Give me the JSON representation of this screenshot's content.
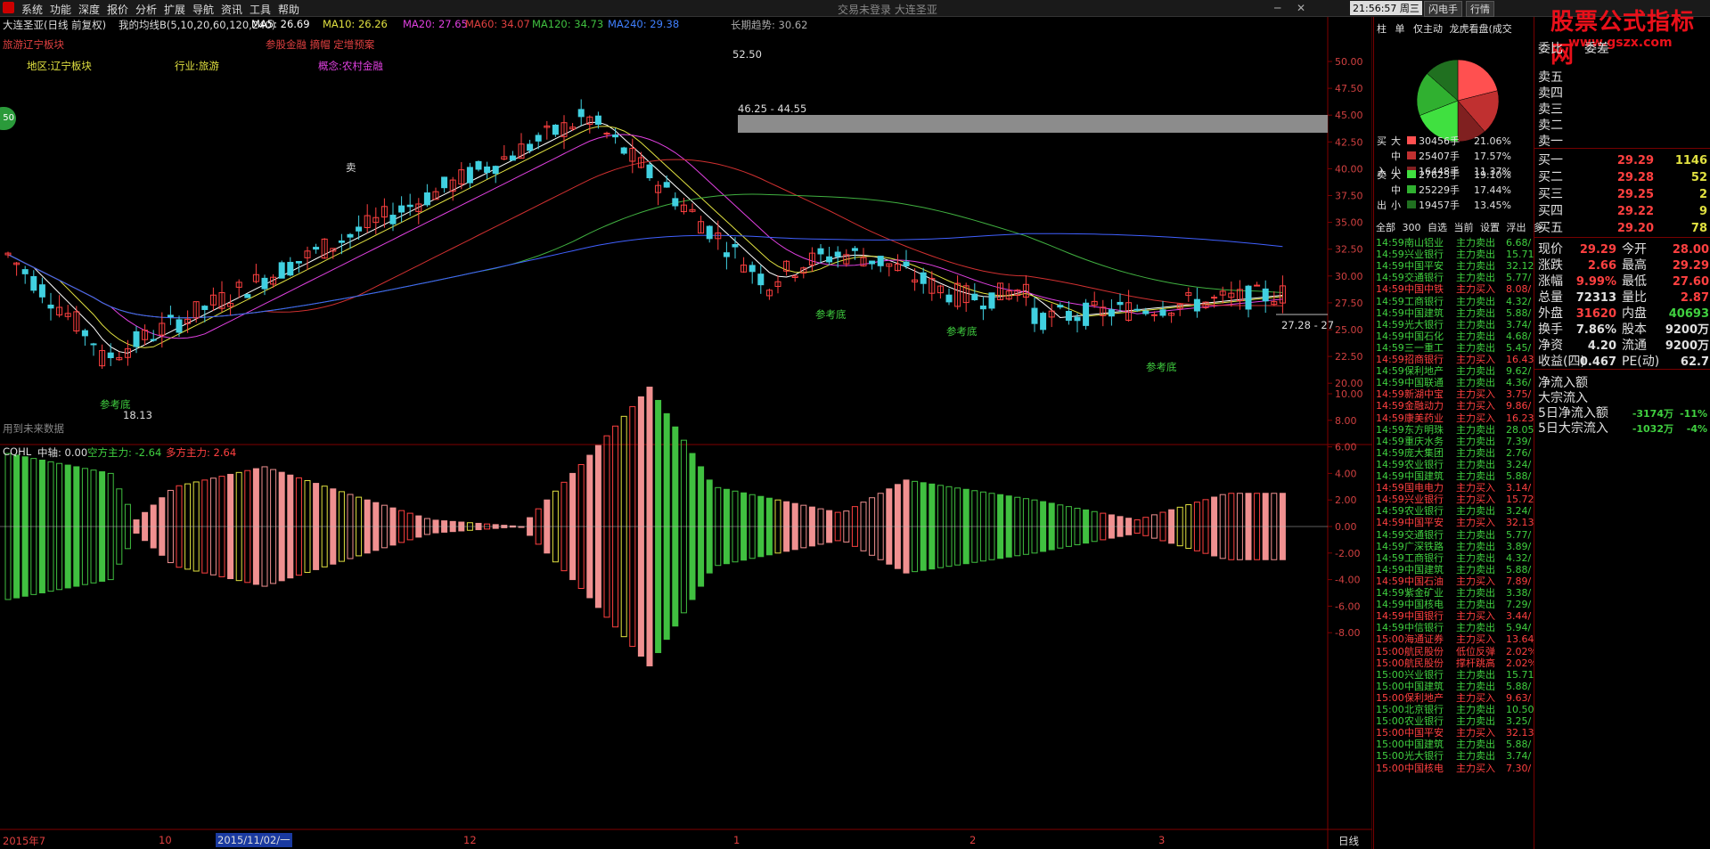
{
  "menu": {
    "items": [
      "系统",
      "功能",
      "深度",
      "报价",
      "分析",
      "扩展",
      "导航",
      "资讯",
      "工具",
      "帮助"
    ],
    "center_title": "交易未登录  大连圣亚",
    "clock": "21:56:57 周三",
    "right_buttons": [
      "闪电手",
      "行情"
    ]
  },
  "brand": {
    "name": "股票公式指标网",
    "url": "www.gszx.com"
  },
  "header": {
    "stock": "大连圣亚(日线 前复权)",
    "ma_group": "我的均线B(5,10,20,60,120,240)",
    "ma5": "MA5: 26.69",
    "ma10": "MA10: 26.26",
    "ma20": "MA20: 27.65",
    "ma60": "MA60: 34.07",
    "ma120": "MA120: 34.73",
    "ma240": "MA240: 29.38",
    "trend": "长期趋势: 30.62"
  },
  "sector": {
    "travel": "旅游辽宁板块",
    "concept_tags": "参股金融 摘帽 定增预案",
    "region": "地区:辽宁板块",
    "industry": "行业:旅游",
    "concept": "概念:农村金融"
  },
  "badge_left": "50",
  "future_note": "用到未来数据",
  "annotations": {
    "peak": "52.50",
    "zone": "46.25 - 44.55",
    "low_label": "18.13",
    "last_label": "27.28 - 27",
    "bottom_marks": [
      "参考底",
      "参考底",
      "参考底",
      "参考底"
    ],
    "sell_mark": "卖"
  },
  "price_axis": [
    "50.00",
    "47.50",
    "45.00",
    "42.50",
    "40.00",
    "37.50",
    "35.00",
    "32.50",
    "30.00",
    "27.50",
    "25.00",
    "22.50",
    "20.00"
  ],
  "indicator": {
    "name": "CQHL",
    "mid": "中轴: 0.00",
    "bear": "空方主力: -2.64",
    "bull": "多方主力: 2.64",
    "axis": [
      "10.00",
      "8.00",
      "6.00",
      "4.00",
      "2.00",
      "0.00",
      "-2.00",
      "-4.00",
      "-6.00",
      "-8.00"
    ]
  },
  "date_axis": {
    "labels": [
      "2015年7",
      "10",
      "2015/11/02/一",
      "12",
      "1",
      "2",
      "3"
    ],
    "period": "日线"
  },
  "right_tabs": [
    "柱",
    "单",
    "仅主动",
    "龙虎看盘(成交"
  ],
  "flow_sides": {
    "buy": "买入",
    "sell": "卖出"
  },
  "flow": {
    "buy": [
      {
        "size": "大",
        "vol": "30456手",
        "pct": "21.06%"
      },
      {
        "size": "中",
        "vol": "25407手",
        "pct": "17.57%"
      },
      {
        "size": "小",
        "vol": "16448手",
        "pct": "11.37%"
      }
    ],
    "sell": [
      {
        "size": "大",
        "vol": "27625手",
        "pct": "19.10%"
      },
      {
        "size": "中",
        "vol": "25229手",
        "pct": "17.44%"
      },
      {
        "size": "小",
        "vol": "19457手",
        "pct": "13.45%"
      }
    ]
  },
  "list_tabs": [
    "全部",
    "300",
    "自选",
    "当前",
    "设置",
    "浮出",
    "多"
  ],
  "trades": [
    {
      "t": "14:59",
      "n": "南山铝业",
      "a": "主力卖出",
      "v": "6.68/",
      "c": "green"
    },
    {
      "t": "14:59",
      "n": "兴业银行",
      "a": "主力卖出",
      "v": "15.71",
      "c": "green"
    },
    {
      "t": "14:59",
      "n": "中国平安",
      "a": "主力卖出",
      "v": "32.12",
      "c": "green"
    },
    {
      "t": "14:59",
      "n": "交通银行",
      "a": "主力卖出",
      "v": "5.77/",
      "c": "green"
    },
    {
      "t": "14:59",
      "n": "中国中铁",
      "a": "主力买入",
      "v": "8.08/",
      "c": "red"
    },
    {
      "t": "14:59",
      "n": "工商银行",
      "a": "主力卖出",
      "v": "4.32/",
      "c": "green"
    },
    {
      "t": "14:59",
      "n": "中国建筑",
      "a": "主力卖出",
      "v": "5.88/",
      "c": "green"
    },
    {
      "t": "14:59",
      "n": "光大银行",
      "a": "主力卖出",
      "v": "3.74/",
      "c": "green"
    },
    {
      "t": "14:59",
      "n": "中国石化",
      "a": "主力卖出",
      "v": "4.68/",
      "c": "green"
    },
    {
      "t": "14:59",
      "n": "三一重工",
      "a": "主力卖出",
      "v": "5.45/",
      "c": "green"
    },
    {
      "t": "14:59",
      "n": "招商银行",
      "a": "主力买入",
      "v": "16.43",
      "c": "red"
    },
    {
      "t": "14:59",
      "n": "保利地产",
      "a": "主力卖出",
      "v": "9.62/",
      "c": "green"
    },
    {
      "t": "14:59",
      "n": "中国联通",
      "a": "主力卖出",
      "v": "4.36/",
      "c": "green"
    },
    {
      "t": "14:59",
      "n": "新湖中宝",
      "a": "主力买入",
      "v": "3.75/",
      "c": "red"
    },
    {
      "t": "14:59",
      "n": "金融动力",
      "a": "主力买入",
      "v": "9.86/",
      "c": "red"
    },
    {
      "t": "14:59",
      "n": "康美药业",
      "a": "主力买入",
      "v": "16.23",
      "c": "red"
    },
    {
      "t": "14:59",
      "n": "东方明珠",
      "a": "主力卖出",
      "v": "28.05",
      "c": "green"
    },
    {
      "t": "14:59",
      "n": "重庆水务",
      "a": "主力卖出",
      "v": "7.39/",
      "c": "green"
    },
    {
      "t": "14:59",
      "n": "庞大集团",
      "a": "主力卖出",
      "v": "2.76/",
      "c": "green"
    },
    {
      "t": "14:59",
      "n": "农业银行",
      "a": "主力卖出",
      "v": "3.24/",
      "c": "green"
    },
    {
      "t": "14:59",
      "n": "中国建筑",
      "a": "主力卖出",
      "v": "5.88/",
      "c": "green"
    },
    {
      "t": "14:59",
      "n": "国电电力",
      "a": "主力买入",
      "v": "3.14/",
      "c": "red"
    },
    {
      "t": "14:59",
      "n": "兴业银行",
      "a": "主力买入",
      "v": "15.72",
      "c": "red"
    },
    {
      "t": "14:59",
      "n": "农业银行",
      "a": "主力卖出",
      "v": "3.24/",
      "c": "green"
    },
    {
      "t": "14:59",
      "n": "中国平安",
      "a": "主力买入",
      "v": "32.13",
      "c": "red"
    },
    {
      "t": "14:59",
      "n": "交通银行",
      "a": "主力卖出",
      "v": "5.77/",
      "c": "green"
    },
    {
      "t": "14:59",
      "n": "广深铁路",
      "a": "主力卖出",
      "v": "3.89/",
      "c": "green"
    },
    {
      "t": "14:59",
      "n": "工商银行",
      "a": "主力卖出",
      "v": "4.32/",
      "c": "green"
    },
    {
      "t": "14:59",
      "n": "中国建筑",
      "a": "主力卖出",
      "v": "5.88/",
      "c": "green"
    },
    {
      "t": "14:59",
      "n": "中国石油",
      "a": "主力买入",
      "v": "7.89/",
      "c": "red"
    },
    {
      "t": "14:59",
      "n": "紫金矿业",
      "a": "主力卖出",
      "v": "3.38/",
      "c": "green"
    },
    {
      "t": "14:59",
      "n": "中国核电",
      "a": "主力卖出",
      "v": "7.29/",
      "c": "green"
    },
    {
      "t": "14:59",
      "n": "中国银行",
      "a": "主力买入",
      "v": "3.44/",
      "c": "red"
    },
    {
      "t": "14:59",
      "n": "中信银行",
      "a": "主力卖出",
      "v": "5.94/",
      "c": "green"
    },
    {
      "t": "15:00",
      "n": "海通证券",
      "a": "主力买入",
      "v": "13.64",
      "c": "red"
    },
    {
      "t": "15:00",
      "n": "航民股份",
      "a": "低位反弹",
      "v": "2.02%",
      "c": "red"
    },
    {
      "t": "15:00",
      "n": "航民股份",
      "a": "撑杆跳高",
      "v": "2.02%",
      "c": "red"
    },
    {
      "t": "15:00",
      "n": "兴业银行",
      "a": "主力卖出",
      "v": "15.71",
      "c": "green"
    },
    {
      "t": "15:00",
      "n": "中国建筑",
      "a": "主力卖出",
      "v": "5.88/",
      "c": "green"
    },
    {
      "t": "15:00",
      "n": "保利地产",
      "a": "主力买入",
      "v": "9.63/",
      "c": "red"
    },
    {
      "t": "15:00",
      "n": "北京银行",
      "a": "主力卖出",
      "v": "10.50",
      "c": "green"
    },
    {
      "t": "15:00",
      "n": "农业银行",
      "a": "主力卖出",
      "v": "3.25/",
      "c": "green"
    },
    {
      "t": "15:00",
      "n": "中国平安",
      "a": "主力买入",
      "v": "32.13",
      "c": "red"
    },
    {
      "t": "15:00",
      "n": "中国建筑",
      "a": "主力卖出",
      "v": "5.88/",
      "c": "green"
    },
    {
      "t": "15:00",
      "n": "光大银行",
      "a": "主力卖出",
      "v": "3.74/",
      "c": "green"
    },
    {
      "t": "15:00",
      "n": "中国核电",
      "a": "主力买入",
      "v": "7.30/",
      "c": "red"
    }
  ],
  "orderbook": {
    "ratio_lbl": "委比",
    "diff_lbl": "委差",
    "sells": [
      {
        "l": "卖五"
      },
      {
        "l": "卖四"
      },
      {
        "l": "卖三"
      },
      {
        "l": "卖二"
      },
      {
        "l": "卖一"
      }
    ],
    "buys": [
      {
        "l": "买一",
        "p": "29.29",
        "v": "1146"
      },
      {
        "l": "买二",
        "p": "29.28",
        "v": "52"
      },
      {
        "l": "买三",
        "p": "29.25",
        "v": "2"
      },
      {
        "l": "买四",
        "p": "29.22",
        "v": "9"
      },
      {
        "l": "买五",
        "p": "29.20",
        "v": "78"
      }
    ]
  },
  "quote": [
    {
      "l1": "现价",
      "v1": "29.29",
      "c1": "red",
      "l2": "今开",
      "v2": "28.00",
      "c2": "red"
    },
    {
      "l1": "涨跌",
      "v1": "2.66",
      "c1": "red",
      "l2": "最高",
      "v2": "29.29",
      "c2": "red"
    },
    {
      "l1": "涨幅",
      "v1": "9.99%",
      "c1": "red",
      "l2": "最低",
      "v2": "27.60",
      "c2": "red"
    },
    {
      "l1": "总量",
      "v1": "72313",
      "c1": "white",
      "l2": "量比",
      "v2": "2.87",
      "c2": "red"
    },
    {
      "l1": "外盘",
      "v1": "31620",
      "c1": "red",
      "l2": "内盘",
      "v2": "40693",
      "c2": "green"
    },
    {
      "l1": "换手",
      "v1": "7.86%",
      "c1": "white",
      "l2": "股本",
      "v2": "9200万",
      "c2": "white"
    },
    {
      "l1": "净资",
      "v1": "4.20",
      "c1": "white",
      "l2": "流通",
      "v2": "9200万",
      "c2": "white"
    },
    {
      "l1": "收益(四)",
      "v1": "0.467",
      "c1": "white",
      "l2": "PE(动)",
      "v2": "62.7",
      "c2": "white"
    }
  ],
  "netflow": [
    {
      "l": "净流入额",
      "v": "",
      "p": ""
    },
    {
      "l": "大宗流入",
      "v": "",
      "p": ""
    },
    {
      "l": "5日净流入额",
      "v": "-3174万",
      "p": "-11%"
    },
    {
      "l": "5日大宗流入",
      "v": "-1032万",
      "p": "-4%"
    }
  ],
  "colors": {
    "up": "#ff4040",
    "down": "#40d0e0",
    "ma5": "#ffffff",
    "ma10": "#e0e040",
    "ma20": "#e040e0",
    "ma60": "#d03030",
    "ma120": "#40b040",
    "ma240": "#4060ff"
  }
}
